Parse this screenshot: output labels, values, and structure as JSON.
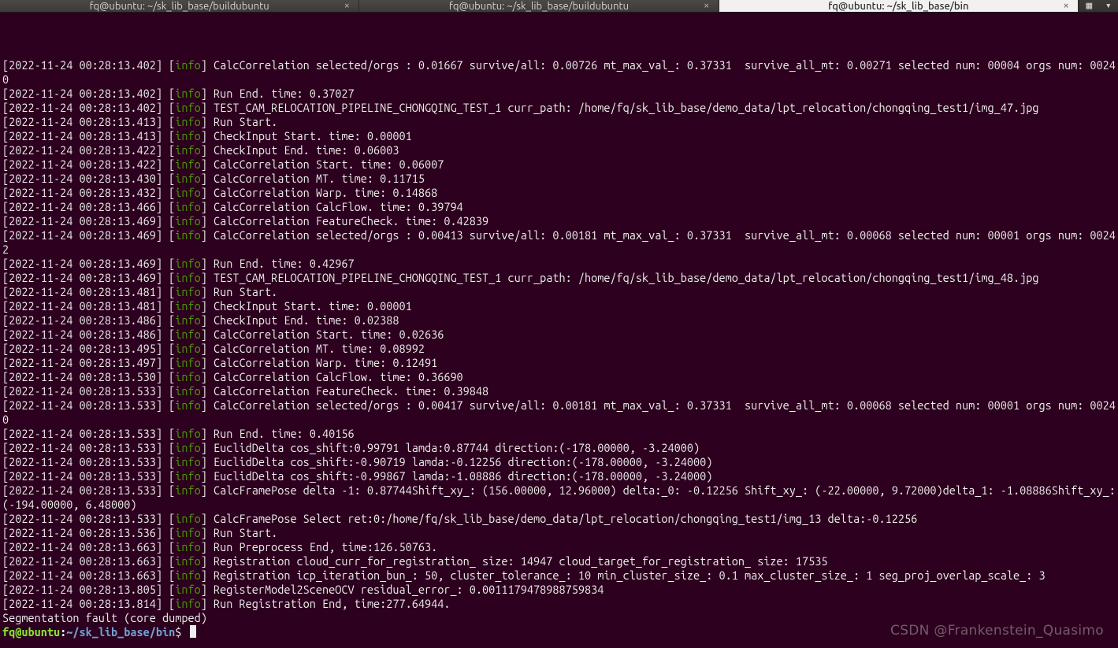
{
  "tabs": [
    {
      "title": "fq@ubuntu: ~/sk_lib_base/buildubuntu",
      "active": false
    },
    {
      "title": "fq@ubuntu: ~/sk_lib_base/buildubuntu",
      "active": false
    },
    {
      "title": "fq@ubuntu: ~/sk_lib_base/bin",
      "active": true
    }
  ],
  "tab_new_icon": "▦",
  "tab_menu_icon": "▾",
  "close_glyph": "×",
  "log_level": "info",
  "log": [
    {
      "ts": "2022-11-24 00:28:13.402",
      "msg": "CalcCorrelation selected/orgs : 0.01667 survive/all: 0.00726 mt_max_val_: 0.37331  survive_all_mt: 0.00271 selected num: 00004 orgs num: 00240"
    },
    {
      "ts": "2022-11-24 00:28:13.402",
      "msg": "Run End. time: 0.37027"
    },
    {
      "ts": "2022-11-24 00:28:13.402",
      "msg": "TEST_CAM_RELOCATION_PIPELINE_CHONGQING_TEST_1 curr_path: /home/fq/sk_lib_base/demo_data/lpt_relocation/chongqing_test1/img_47.jpg"
    },
    {
      "ts": "2022-11-24 00:28:13.413",
      "msg": "Run Start."
    },
    {
      "ts": "2022-11-24 00:28:13.413",
      "msg": "CheckInput Start. time: 0.00001"
    },
    {
      "ts": "2022-11-24 00:28:13.422",
      "msg": "CheckInput End. time: 0.06003"
    },
    {
      "ts": "2022-11-24 00:28:13.422",
      "msg": "CalcCorrelation Start. time: 0.06007"
    },
    {
      "ts": "2022-11-24 00:28:13.430",
      "msg": "CalcCorrelation MT. time: 0.11715"
    },
    {
      "ts": "2022-11-24 00:28:13.432",
      "msg": "CalcCorrelation Warp. time: 0.14868"
    },
    {
      "ts": "2022-11-24 00:28:13.466",
      "msg": "CalcCorrelation CalcFlow. time: 0.39794"
    },
    {
      "ts": "2022-11-24 00:28:13.469",
      "msg": "CalcCorrelation FeatureCheck. time: 0.42839"
    },
    {
      "ts": "2022-11-24 00:28:13.469",
      "msg": "CalcCorrelation selected/orgs : 0.00413 survive/all: 0.00181 mt_max_val_: 0.37331  survive_all_mt: 0.00068 selected num: 00001 orgs num: 00242"
    },
    {
      "ts": "2022-11-24 00:28:13.469",
      "msg": "Run End. time: 0.42967"
    },
    {
      "ts": "2022-11-24 00:28:13.469",
      "msg": "TEST_CAM_RELOCATION_PIPELINE_CHONGQING_TEST_1 curr_path: /home/fq/sk_lib_base/demo_data/lpt_relocation/chongqing_test1/img_48.jpg"
    },
    {
      "ts": "2022-11-24 00:28:13.481",
      "msg": "Run Start."
    },
    {
      "ts": "2022-11-24 00:28:13.481",
      "msg": "CheckInput Start. time: 0.00001"
    },
    {
      "ts": "2022-11-24 00:28:13.486",
      "msg": "CheckInput End. time: 0.02388"
    },
    {
      "ts": "2022-11-24 00:28:13.486",
      "msg": "CalcCorrelation Start. time: 0.02636"
    },
    {
      "ts": "2022-11-24 00:28:13.495",
      "msg": "CalcCorrelation MT. time: 0.08992"
    },
    {
      "ts": "2022-11-24 00:28:13.497",
      "msg": "CalcCorrelation Warp. time: 0.12491"
    },
    {
      "ts": "2022-11-24 00:28:13.530",
      "msg": "CalcCorrelation CalcFlow. time: 0.36690"
    },
    {
      "ts": "2022-11-24 00:28:13.533",
      "msg": "CalcCorrelation FeatureCheck. time: 0.39848"
    },
    {
      "ts": "2022-11-24 00:28:13.533",
      "msg": "CalcCorrelation selected/orgs : 0.00417 survive/all: 0.00181 mt_max_val_: 0.37331  survive_all_mt: 0.00068 selected num: 00001 orgs num: 00240"
    },
    {
      "ts": "2022-11-24 00:28:13.533",
      "msg": "Run End. time: 0.40156"
    },
    {
      "ts": "2022-11-24 00:28:13.533",
      "msg": "EuclidDelta cos_shift:0.99791 lamda:0.87744 direction:(-178.00000, -3.24000)"
    },
    {
      "ts": "2022-11-24 00:28:13.533",
      "msg": "EuclidDelta cos_shift:-0.90719 lamda:-0.12256 direction:(-178.00000, -3.24000)"
    },
    {
      "ts": "2022-11-24 00:28:13.533",
      "msg": "EuclidDelta cos_shift:-0.99867 lamda:-1.08886 direction:(-178.00000, -3.24000)"
    },
    {
      "ts": "2022-11-24 00:28:13.533",
      "msg": "CalcFramePose delta -1: 0.87744Shift_xy_: (156.00000, 12.96000) delta:_0: -0.12256 Shift_xy_: (-22.00000, 9.72000)delta_1: -1.08886Shift_xy_: (-194.00000, 6.48000)"
    },
    {
      "ts": "2022-11-24 00:28:13.533",
      "msg": "CalcFramePose Select ret:0:/home/fq/sk_lib_base/demo_data/lpt_relocation/chongqing_test1/img_13 delta:-0.12256"
    },
    {
      "ts": "2022-11-24 00:28:13.536",
      "msg": "Run Start."
    },
    {
      "ts": "2022-11-24 00:28:13.663",
      "msg": "Run Preprocess End, time:126.50763."
    },
    {
      "ts": "2022-11-24 00:28:13.663",
      "msg": "Registration cloud_curr_for_registration_ size: 14947 cloud_target_for_registration_ size: 17535"
    },
    {
      "ts": "2022-11-24 00:28:13.663",
      "msg": "Registration icp_iteration_bun_: 50, cluster_tolerance_: 10 min_cluster_size_: 0.1 max_cluster_size_: 1 seg_proj_overlap_scale_: 3"
    },
    {
      "ts": "2022-11-24 00:28:13.805",
      "msg": "RegisterModel2SceneOCV residual_error_: 0.0011179478988759834"
    },
    {
      "ts": "2022-11-24 00:28:13.814",
      "msg": "Run Registration End, time:277.64944."
    }
  ],
  "plain_lines": [
    "Segmentation fault (core dumped)"
  ],
  "prompt": {
    "user": "fq",
    "host": "ubuntu",
    "path": "~/sk_lib_base/bin",
    "symbol": "$"
  },
  "watermark": "CSDN @Frankenstein_Quasimo"
}
